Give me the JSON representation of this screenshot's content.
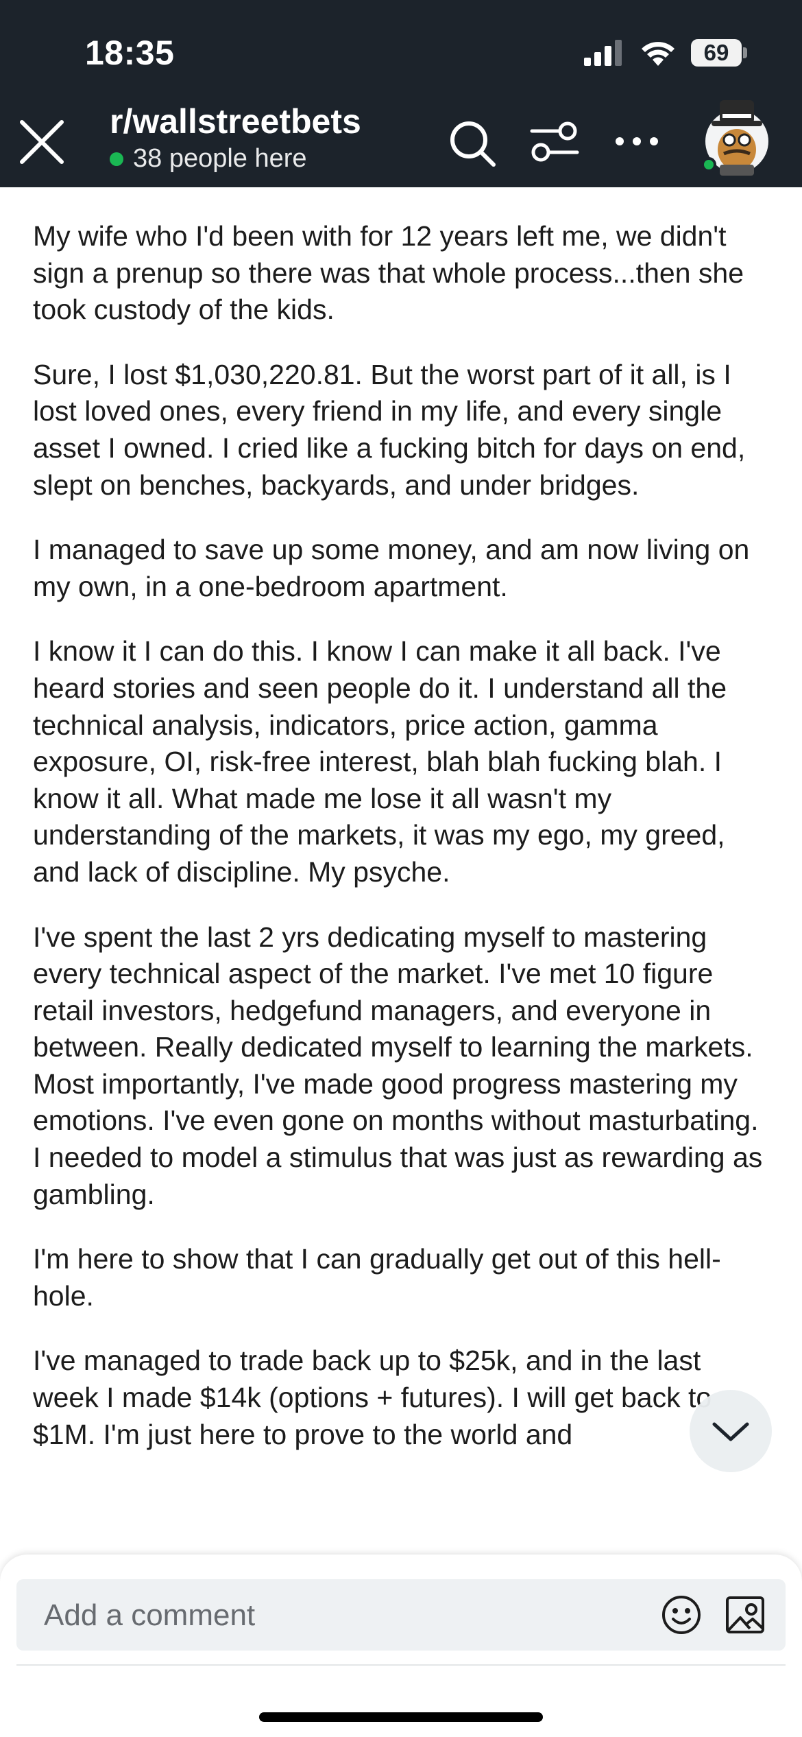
{
  "status_bar": {
    "time": "18:35",
    "battery": "69"
  },
  "header": {
    "subreddit": "r/wallstreetbets",
    "online": "38 people here",
    "icons": [
      "close-icon",
      "search-icon",
      "filter-icon",
      "more-icon",
      "avatar"
    ],
    "online_color": "#1ab753"
  },
  "post": {
    "paragraphs": [
      "My wife who I'd been with for 12 years left me, we didn't sign a prenup so there was that whole process...then she took custody of the kids.",
      "Sure, I lost $1,030,220.81. But the worst part of it all, is I lost loved ones, every friend in my life, and every single asset I owned. I cried like a fucking bitch for days on end, slept on benches, backyards, and under bridges.",
      "I managed to save up some money, and am now living on my own, in a one-bedroom apartment.",
      "I know it I can do this. I know I can make it all back. I've heard stories and seen people do it. I understand all the technical analysis, indicators, price action, gamma exposure, OI, risk-free interest, blah blah fucking blah. I know it all. What made me lose it all wasn't my understanding of the markets, it was my ego, my greed, and lack of discipline. My psyche.",
      "I've spent the last 2 yrs dedicating myself to mastering every technical aspect of the market. I've met 10 figure retail investors, hedgefund managers, and everyone in between. Really dedicated myself to learning the markets. Most importantly, I've made good progress mastering my emotions. I've even gone on months without masturbating. I needed to model a stimulus that was just as rewarding as gambling.",
      "I'm here to show that I can gradually get out of this hell-hole.",
      "I've managed to trade back up to $25k, and in the last week I made $14k (options + futures). I will get back to $1M. I'm just here to prove to the world and"
    ]
  },
  "comment": {
    "placeholder": "Add a comment",
    "icons": [
      "emoji-icon",
      "image-icon"
    ]
  }
}
